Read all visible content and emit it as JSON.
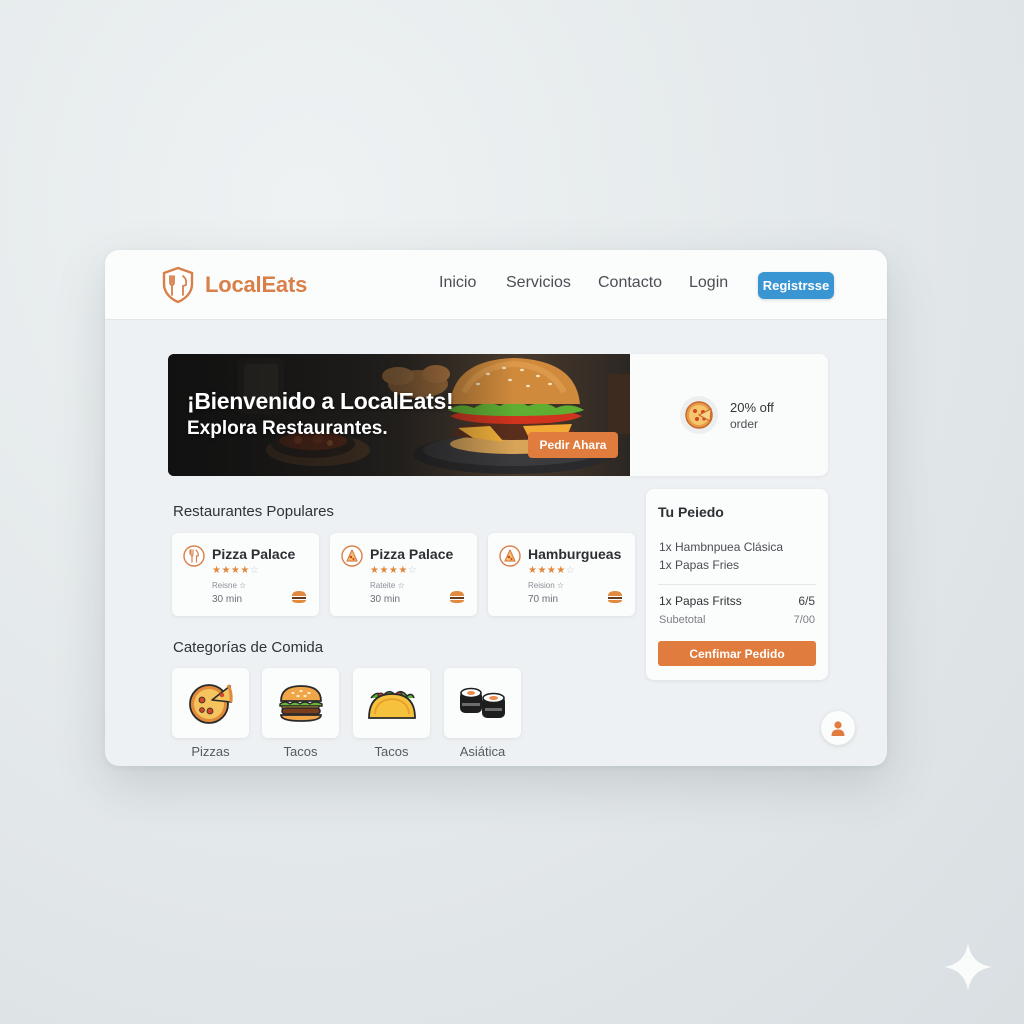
{
  "brand": {
    "name": "LocalEats",
    "color": "#d9804a"
  },
  "nav": {
    "items": [
      "Inicio",
      "Servicios",
      "Contacto",
      "Login"
    ],
    "signup_label": "Registrsse",
    "signup_color": "#3a95d3"
  },
  "hero": {
    "title": "¡Bienvenido a LocalEats!",
    "subtitle": "Explora Restaurantes.",
    "cta_label": "Pedir Ahara",
    "accent": "#e07c3e"
  },
  "promo": {
    "main": "20% off",
    "sub": "order",
    "icon": "pizza-icon"
  },
  "popular": {
    "title": "Restaurantes Populares",
    "restaurants": [
      {
        "name": "Pizza Palace",
        "icon": "fork-knife-icon",
        "rating": 4,
        "reviews": "Reisne ☆",
        "time": "30 min"
      },
      {
        "name": "Pizza Palace",
        "icon": "pizza-slice-icon",
        "rating": 4,
        "reviews": "Rateite ☆",
        "time": "30 min"
      },
      {
        "name": "Hamburgueas",
        "icon": "pizza-slice-icon",
        "rating": 4,
        "reviews": "Reision ☆",
        "time": "70 min"
      }
    ]
  },
  "categories": {
    "title": "Categorías de Comida",
    "items": [
      {
        "label": "Pizzas",
        "icon": "pizza-icon"
      },
      {
        "label": "Tacos",
        "icon": "burger-icon"
      },
      {
        "label": "Tacos",
        "icon": "taco-icon"
      },
      {
        "label": "Asiática",
        "icon": "sushi-icon"
      }
    ]
  },
  "order": {
    "title": "Tu Peiedo",
    "lines": [
      "1x Hambnpuea Clásica",
      "1x Papas Fries"
    ],
    "total_row": {
      "label": "1x Papas Fritss",
      "value": "6/5"
    },
    "subtotal_row": {
      "label": "Subetotal",
      "value": "7/00"
    },
    "confirm_label": "Cenfimar Pedido"
  }
}
